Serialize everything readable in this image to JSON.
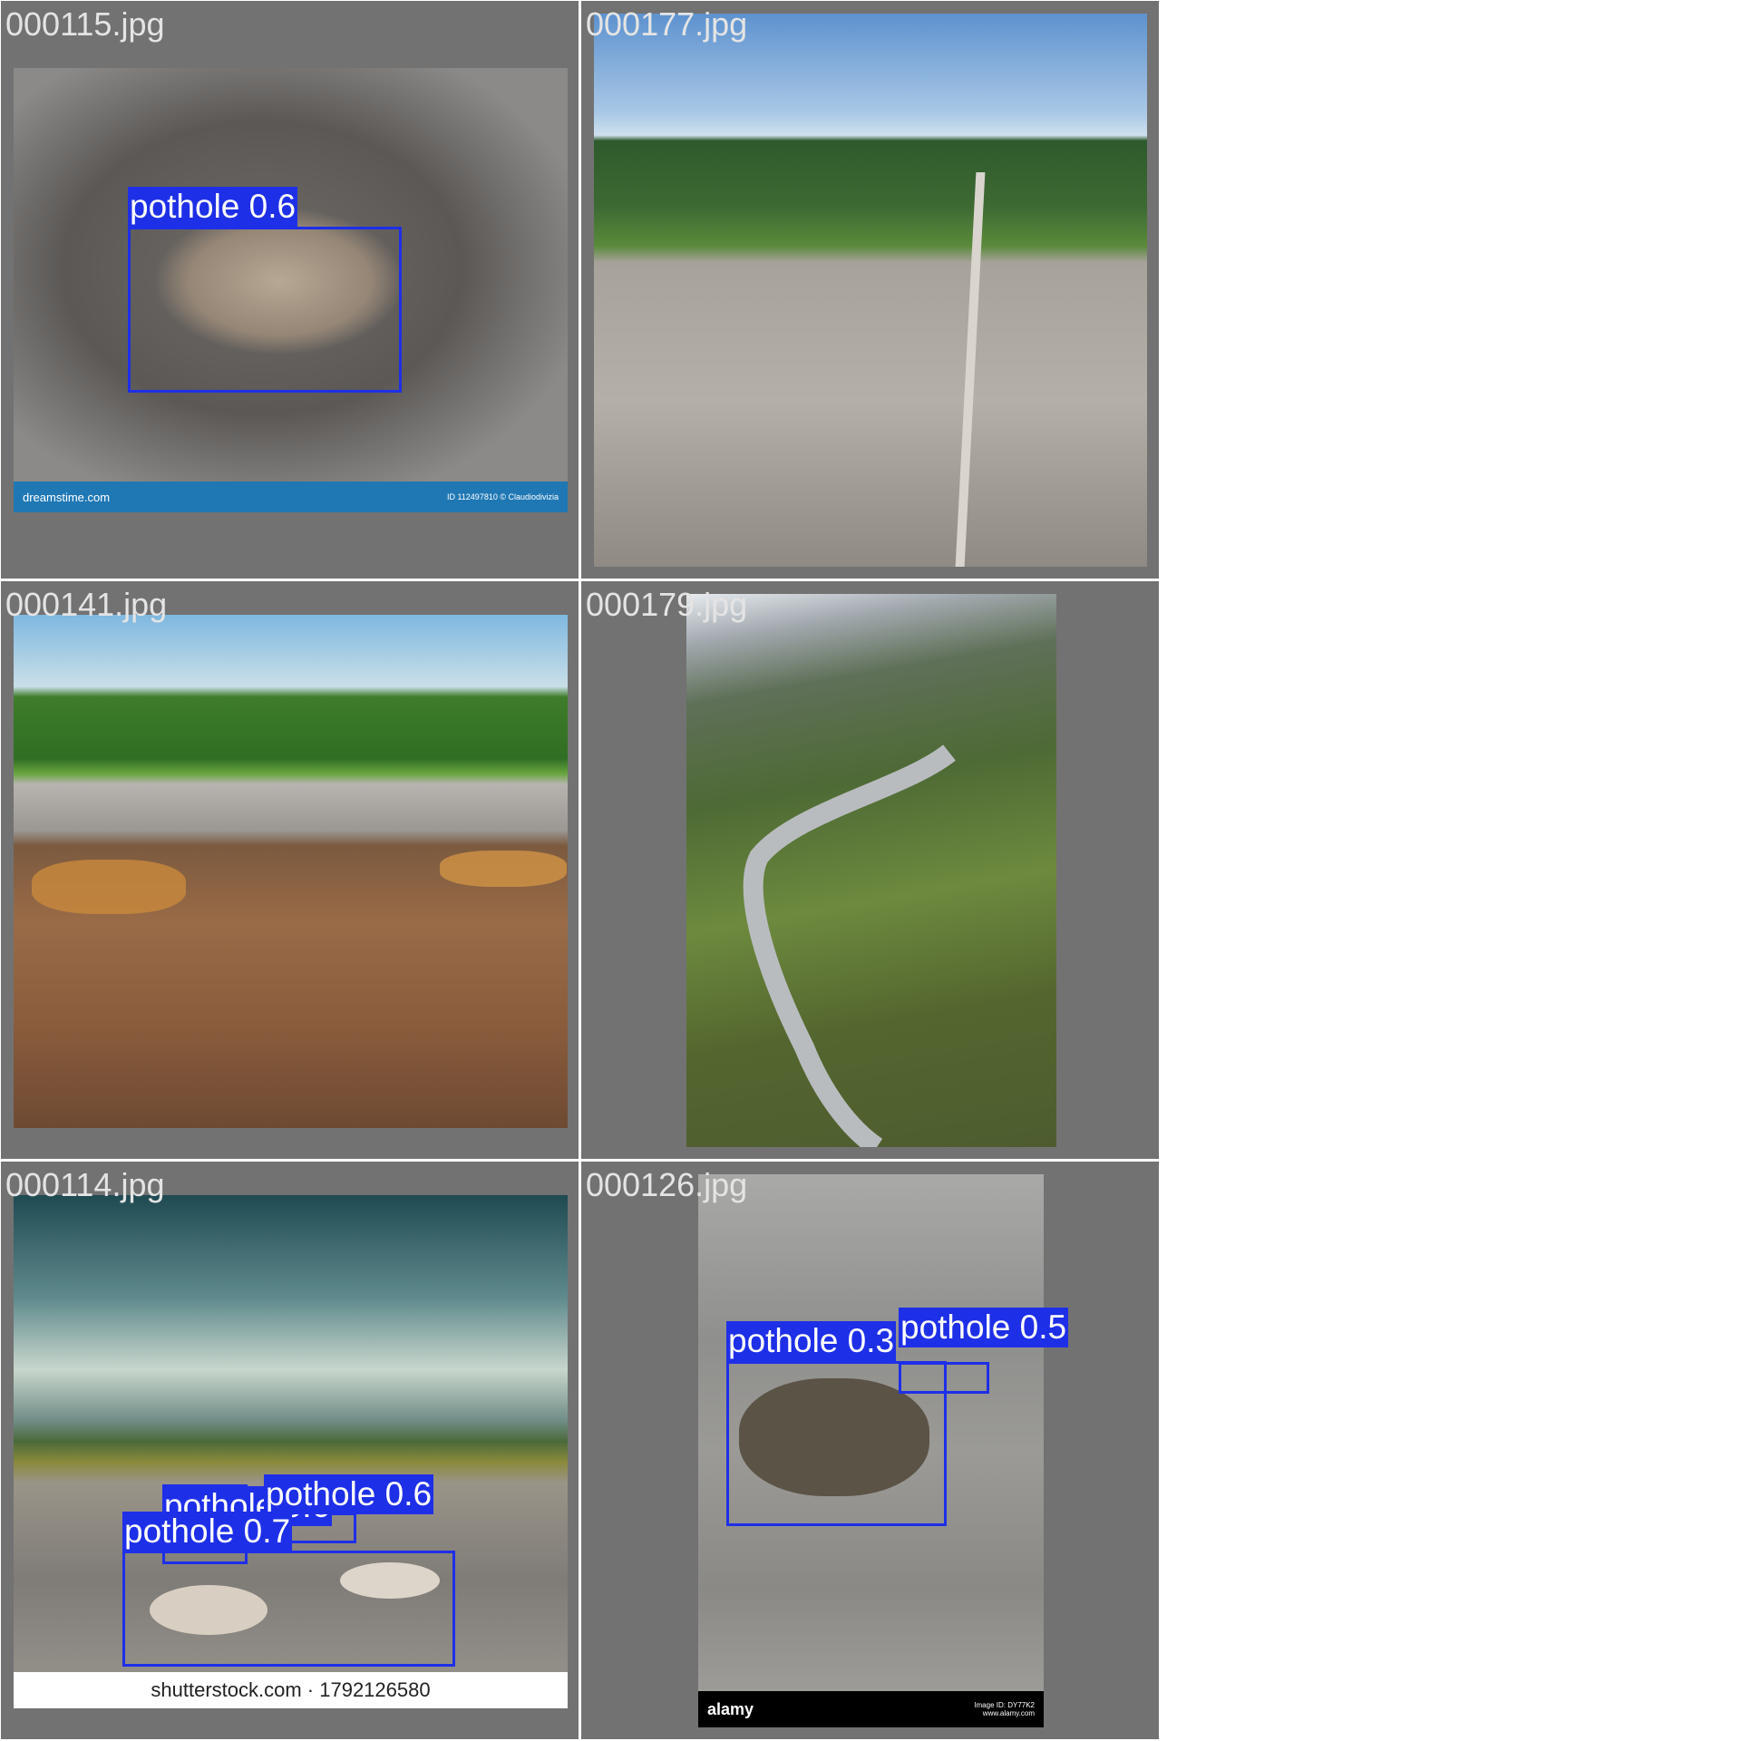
{
  "tiles": [
    {
      "filename": "000115.jpg",
      "detections": [
        {
          "label": "pothole 0.6"
        }
      ],
      "watermark": {
        "left": "dreamstime.com",
        "right": "ID 112497810 © Claudiodivizia"
      }
    },
    {
      "filename": "000177.jpg",
      "detections": []
    },
    {
      "filename": "000141.jpg",
      "detections": []
    },
    {
      "filename": "000179.jpg",
      "detections": []
    },
    {
      "filename": "000114.jpg",
      "detections": [
        {
          "label": "pothole 0.6"
        },
        {
          "label": "pothole 0.7"
        },
        {
          "label": "pothole 0.6"
        }
      ],
      "watermark": {
        "center": "shutterstock.com · 1792126580"
      }
    },
    {
      "filename": "000126.jpg",
      "detections": [
        {
          "label": "pothole 0.3"
        },
        {
          "label": "pothole 0.5"
        }
      ],
      "watermark": {
        "left": "alamy",
        "right": "Image ID: DY77K2 www.alamy.com"
      }
    }
  ],
  "colors": {
    "box": "#1e2fe8",
    "tile_bg": "#727272",
    "filename_text": "#e4e4e4"
  }
}
